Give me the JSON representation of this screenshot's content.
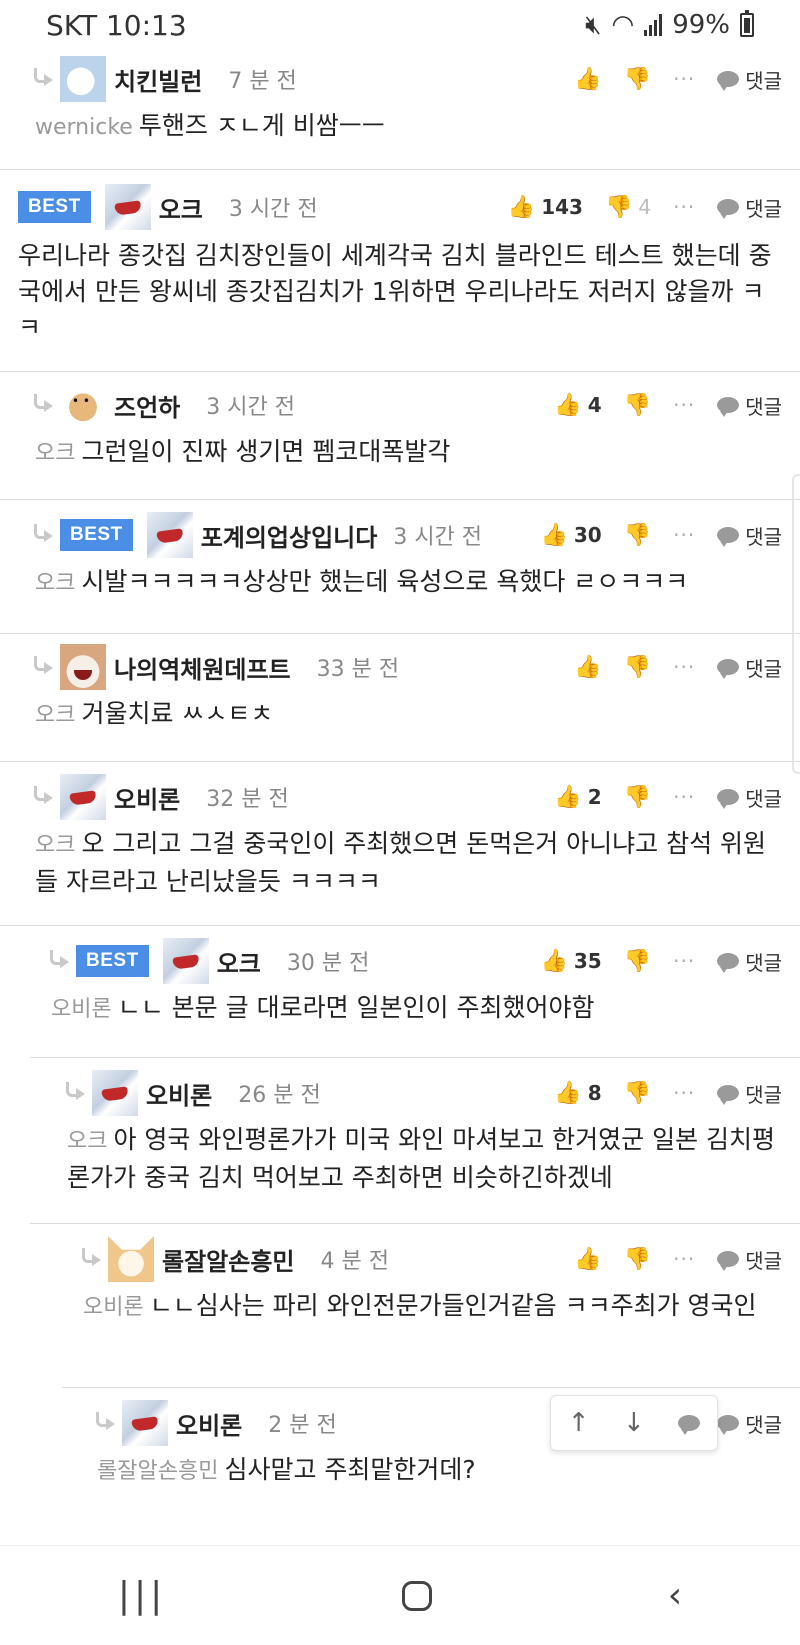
{
  "status": {
    "carrier_time": "SKT 10:13",
    "battery": "99%"
  },
  "comments": [
    {
      "nick": "치킨빌런",
      "time": "7 분 전",
      "mention": "wernicke",
      "text": "투핸즈 ㅈㄴ게 비쌈ㅡㅡ",
      "up": "",
      "down": "",
      "reply": "댓글"
    },
    {
      "best": "BEST",
      "nick": "오크",
      "time": "3 시간 전",
      "text": "우리나라 종갓집 김치장인들이 세계각국 김치 블라인드 테스트 했는데 중국에서 만든 왕씨네 종갓집김치가 1위하면 우리나라도 저러지 않을까 ㅋㅋ",
      "up": "143",
      "down": "4",
      "reply": "댓글"
    },
    {
      "nick": "즈언하",
      "time": "3 시간 전",
      "mention": "오크",
      "text": "그런일이 진짜 생기면 펨코대폭발각",
      "up": "4",
      "down": "",
      "reply": "댓글"
    },
    {
      "best": "BEST",
      "nick": "포계의업상입니다",
      "time": "3 시간 전",
      "mention": "오크",
      "text": "시발ㅋㅋㅋㅋㅋ상상만 했는데 육성으로 욕했다 ㄹㅇㅋㅋㅋ",
      "up": "30",
      "down": "",
      "reply": "댓글"
    },
    {
      "nick": "나의역체원데프트",
      "time": "33 분 전",
      "mention": "오크",
      "text": "거울치료 ㅆㅅㅌㅊ",
      "up": "",
      "down": "",
      "reply": "댓글"
    },
    {
      "nick": "오비론",
      "time": "32 분 전",
      "mention": "오크",
      "text": "오 그리고 그걸 중국인이 주최했으면 돈먹은거 아니냐고 참석 위원들 자르라고 난리났을듯 ㅋㅋㅋㅋ",
      "up": "2",
      "down": "",
      "reply": "댓글"
    },
    {
      "best": "BEST",
      "nick": "오크",
      "time": "30 분 전",
      "mention": "오비론",
      "text": "ㄴㄴ 본문 글 대로라면 일본인이 주최했어야함",
      "up": "35",
      "down": "",
      "reply": "댓글"
    },
    {
      "nick": "오비론",
      "time": "26 분 전",
      "mention": "오크",
      "text": "아 영국 와인평론가가 미국 와인 마셔보고 한거였군 일본 김치평론가가 중국 김치 먹어보고 주최하면 비슷하긴하겠네",
      "up": "8",
      "down": "",
      "reply": "댓글"
    },
    {
      "nick": "롤잘알손흥민",
      "time": "4 분 전",
      "mention": "오비론",
      "text": "ㄴㄴ심사는 파리 와인전문가들인거같음 ㅋㅋ주최가 영국인",
      "up": "",
      "down": "",
      "reply": "댓글"
    },
    {
      "nick": "오비론",
      "time": "2 분 전",
      "mention": "롤잘알손흥민",
      "text": "심사맡고 주최맡한거데?",
      "up": "",
      "down": "",
      "reply": "댓글"
    }
  ],
  "icons": {
    "thumb_up": "👍",
    "thumb_down": "👎",
    "more": "···",
    "up_arrow": "↑",
    "down_arrow": "↓"
  },
  "colors": {
    "best_badge": "#4a8ee6"
  }
}
